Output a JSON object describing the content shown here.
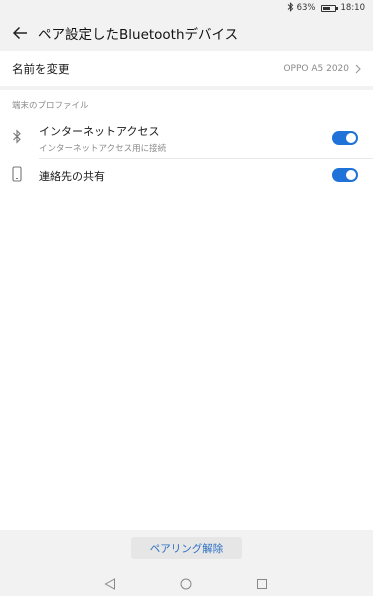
{
  "status_bar": {
    "bluetooth_icon": "bluetooth-icon",
    "battery_percent": "63%",
    "battery_level": 0.63,
    "time": "18:10"
  },
  "header": {
    "back_icon": "arrow-left-icon",
    "title": "ペア設定したBluetoothデバイス"
  },
  "rename": {
    "label": "名前を変更",
    "device_name": "OPPO A5 2020",
    "chevron_icon": "chevron-right-icon"
  },
  "profiles": {
    "section_title": "端末のプロファイル",
    "items": [
      {
        "icon": "bluetooth-icon",
        "label": "インターネットアクセス",
        "sublabel": "インターネットアクセス用に接続",
        "enabled": true
      },
      {
        "icon": "phone-icon",
        "label": "連絡先の共有",
        "enabled": true
      }
    ]
  },
  "actions": {
    "unpair_label": "ペアリング解除"
  },
  "navigation": {
    "back_icon": "triangle-back-icon",
    "home_icon": "circle-home-icon",
    "recents_icon": "square-recents-icon"
  },
  "colors": {
    "accent": "#1e72d8",
    "link": "#2b6fc4",
    "background": "#f2f2f2"
  }
}
